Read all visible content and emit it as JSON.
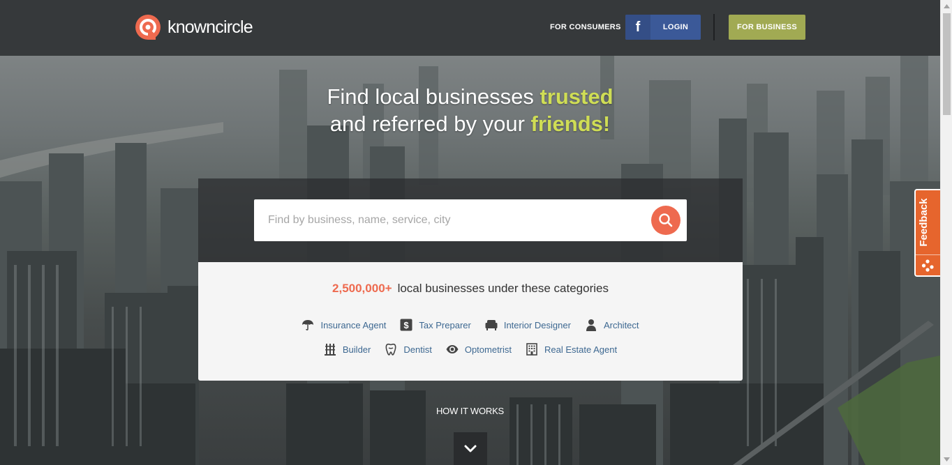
{
  "header": {
    "logo_text": "knowncircle",
    "for_consumers_label": "FOR CONSUMERS",
    "facebook_icon_letter": "f",
    "login_label": "LOGIN",
    "for_business_label": "FOR BUSINESS"
  },
  "hero": {
    "headline_line1_prefix": "Find local businesses ",
    "headline_line1_highlight": "trusted",
    "headline_line2_prefix": "and referred by your ",
    "headline_line2_highlight": "friends!"
  },
  "search": {
    "placeholder": "Find by business, name, service, city",
    "value": "",
    "button_icon": "search-icon"
  },
  "categories": {
    "count": "2,500,000+",
    "count_suffix": "local businesses under these categories",
    "items": [
      {
        "label": "Insurance Agent",
        "icon": "umbrella-icon"
      },
      {
        "label": "Tax Preparer",
        "icon": "dollar-icon"
      },
      {
        "label": "Interior Designer",
        "icon": "armchair-icon"
      },
      {
        "label": "Architect",
        "icon": "person-icon"
      },
      {
        "label": "Builder",
        "icon": "crane-icon"
      },
      {
        "label": "Dentist",
        "icon": "tooth-icon"
      },
      {
        "label": "Optometrist",
        "icon": "eye-icon"
      },
      {
        "label": "Real Estate Agent",
        "icon": "building-icon"
      }
    ]
  },
  "how_it_works": {
    "label": "HOW IT WORKS",
    "button_icon": "chevron-down-icon"
  },
  "feedback": {
    "label": "Feedback",
    "icon": "dots-icon"
  },
  "colors": {
    "header_bg": "#36393b",
    "accent_orange": "#ee6a4f",
    "highlight_green": "#cfdd55",
    "business_button": "#a1aa53",
    "facebook_blue": "#3b5998",
    "link_blue": "#3d6891",
    "feedback_orange": "#e6652d"
  }
}
